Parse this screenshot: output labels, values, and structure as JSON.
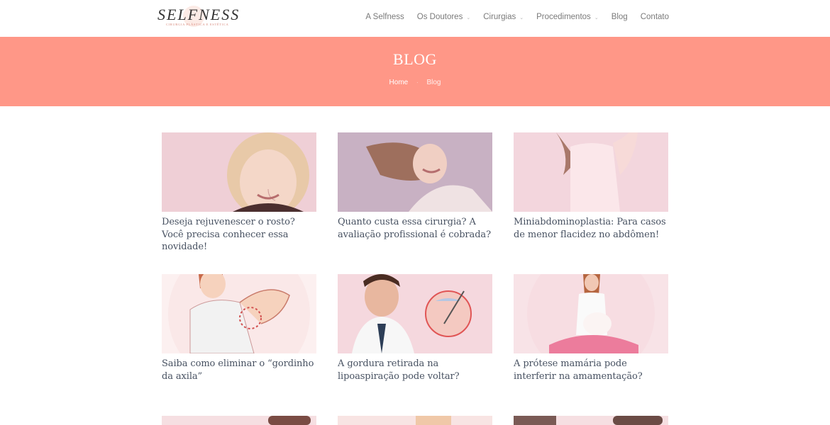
{
  "brand": {
    "name": "SELFNESS",
    "tagline": "Cirurgia Plástica e Estética"
  },
  "nav": {
    "items": [
      {
        "label": "A Selfness",
        "dropdown": false
      },
      {
        "label": "Os Doutores",
        "dropdown": true
      },
      {
        "label": "Cirurgias",
        "dropdown": true
      },
      {
        "label": "Procedimentos",
        "dropdown": true
      },
      {
        "label": "Blog",
        "dropdown": false
      },
      {
        "label": "Contato",
        "dropdown": false
      }
    ]
  },
  "banner": {
    "title": "BLOG",
    "breadcrumb": {
      "home": "Home",
      "separator": "·",
      "current": "Blog"
    },
    "color": "#ff9787"
  },
  "posts": [
    {
      "title": "Deseja rejuvenescer o rosto? Você precisa conhecer essa novidade!",
      "image_icon": "smiling-blonde-woman-photo"
    },
    {
      "title": "Quanto custa essa cirurgia? A avaliação profissional é cobrada?",
      "image_icon": "laughing-woman-photo"
    },
    {
      "title": "Miniabdominoplastia: Para casos de menor flacidez no abdômen!",
      "image_icon": "woman-pink-top-photo"
    },
    {
      "title": "Saiba como eliminar o “gordinho da axila”",
      "image_icon": "underarm-illustration"
    },
    {
      "title": "A gordura retirada na lipoaspiração pode voltar?",
      "image_icon": "doctor-liposuction-photo"
    },
    {
      "title": "A prótese mamária pode interferir na amamentação?",
      "image_icon": "pregnant-woman-photo"
    }
  ]
}
